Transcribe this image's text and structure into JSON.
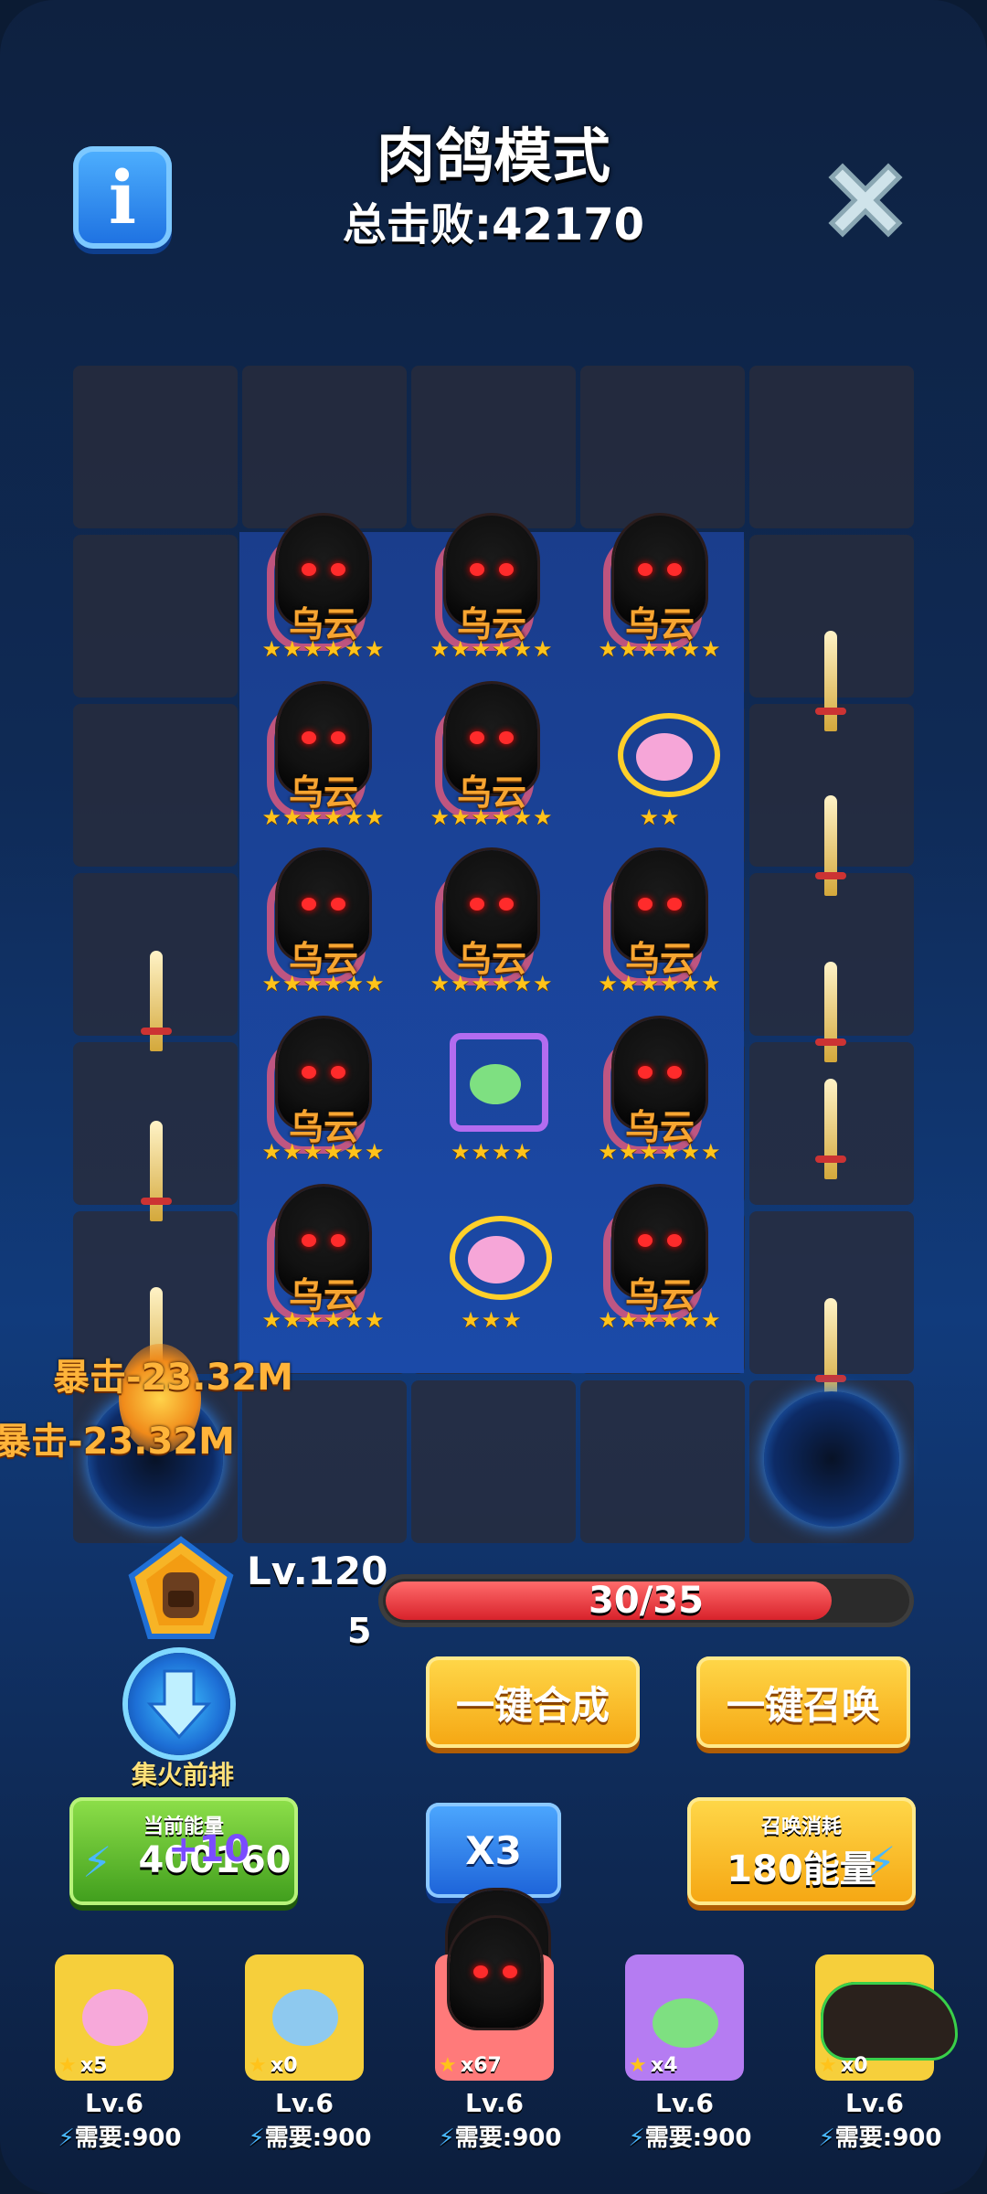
{
  "header": {
    "title": "肉鸽模式",
    "kills_label": "总击败:42170"
  },
  "board": {
    "units": [
      {
        "name": "乌云",
        "stars": "★★★★★★",
        "kind": "reaper"
      },
      {
        "name": "乌云",
        "stars": "★★★★★★",
        "kind": "reaper"
      },
      {
        "name": "乌云",
        "stars": "★★★★★★",
        "kind": "reaper"
      },
      {
        "name": "乌云",
        "stars": "★★★★★★",
        "kind": "reaper"
      },
      {
        "name": "乌云",
        "stars": "★★★★★★",
        "kind": "reaper"
      },
      {
        "name": "",
        "stars": "★★",
        "kind": "pink-slime"
      },
      {
        "name": "乌云",
        "stars": "★★★★★★",
        "kind": "reaper"
      },
      {
        "name": "乌云",
        "stars": "★★★★★★",
        "kind": "reaper"
      },
      {
        "name": "乌云",
        "stars": "★★★★★★",
        "kind": "reaper"
      },
      {
        "name": "乌云",
        "stars": "★★★★★★",
        "kind": "reaper"
      },
      {
        "name": "",
        "stars": "★★★★",
        "kind": "green-slime"
      },
      {
        "name": "乌云",
        "stars": "★★★★★★",
        "kind": "reaper"
      },
      {
        "name": "乌云",
        "stars": "★★★★★★",
        "kind": "reaper"
      },
      {
        "name": "",
        "stars": "★★★",
        "kind": "pink-slime"
      },
      {
        "name": "乌云",
        "stars": "★★★★★★",
        "kind": "reaper"
      }
    ],
    "damage_texts": [
      "暴击-23.32M",
      "暴击-23.32M"
    ]
  },
  "status": {
    "level": "Lv.120",
    "level_sub": "5",
    "hp_text": "30/35",
    "hp_fraction": 0.857
  },
  "actions": {
    "focus_label": "集火前排",
    "merge_label": "一键合成",
    "summon_label": "一键召唤",
    "energy_label": "当前能量",
    "energy_value": "400160",
    "energy_gain": "+10",
    "speed_label": "X3",
    "cost_label": "召唤消耗",
    "cost_value": "180能量"
  },
  "cards": [
    {
      "count": "x5",
      "level": "Lv.6",
      "need": "需要:900",
      "color": "#f6cf3b",
      "kind": "pink-slime"
    },
    {
      "count": "x0",
      "level": "Lv.6",
      "need": "需要:900",
      "color": "#f6cf3b",
      "kind": "blue-slime"
    },
    {
      "count": "x67",
      "level": "Lv.6",
      "need": "需要:900",
      "color": "#ff7a7a",
      "kind": "reaper"
    },
    {
      "count": "x4",
      "level": "Lv.6",
      "need": "需要:900",
      "color": "#b57cf2",
      "kind": "green-slime"
    },
    {
      "count": "x0",
      "level": "Lv.6",
      "need": "需要:900",
      "color": "#f6cf3b",
      "kind": "boar"
    }
  ]
}
